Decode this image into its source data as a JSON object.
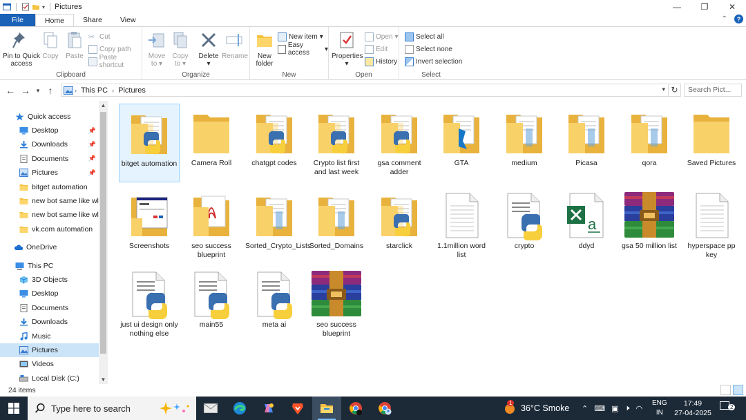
{
  "window": {
    "title": "Pictures"
  },
  "tabs": [
    {
      "label": "File"
    },
    {
      "label": "Home"
    },
    {
      "label": "Share"
    },
    {
      "label": "View"
    }
  ],
  "ribbon": {
    "clipboard": {
      "label": "Clipboard",
      "pin": "Pin to Quick access",
      "copy": "Copy",
      "paste": "Paste",
      "cut": "Cut",
      "copy_path": "Copy path",
      "paste_shortcut": "Paste shortcut"
    },
    "organize": {
      "label": "Organize",
      "move_to": "Move to",
      "copy_to": "Copy to",
      "delete": "Delete",
      "rename": "Rename"
    },
    "new": {
      "label": "New",
      "new_folder": "New folder",
      "new_item": "New item",
      "easy_access": "Easy access"
    },
    "open": {
      "label": "Open",
      "properties": "Properties",
      "open": "Open",
      "edit": "Edit",
      "history": "History"
    },
    "select": {
      "label": "Select",
      "select_all": "Select all",
      "select_none": "Select none",
      "invert": "Invert selection"
    }
  },
  "address": {
    "crumbs": [
      "This PC",
      "Pictures"
    ],
    "search_placeholder": "Search Pict..."
  },
  "nav": {
    "quick_access": "Quick access",
    "qa_items": [
      "Desktop",
      "Downloads",
      "Documents",
      "Pictures",
      "bitget automation",
      "new bot same like wl p",
      "new bot same like wl p",
      "vk.com automation"
    ],
    "onedrive": "OneDrive",
    "this_pc": "This PC",
    "pc_items": [
      "3D Objects",
      "Desktop",
      "Documents",
      "Downloads",
      "Music",
      "Pictures",
      "Videos",
      "Local Disk (C:)"
    ]
  },
  "files": [
    {
      "name": "bitget automation",
      "type": "folder-py"
    },
    {
      "name": "Camera Roll",
      "type": "folder"
    },
    {
      "name": "chatgpt codes",
      "type": "folder-py"
    },
    {
      "name": "Crypto list first and last week",
      "type": "folder-py"
    },
    {
      "name": "gsa comment adder",
      "type": "folder-py"
    },
    {
      "name": "GTA",
      "type": "folder-blue"
    },
    {
      "name": "medium",
      "type": "folder-doc"
    },
    {
      "name": "Picasa",
      "type": "folder-doc"
    },
    {
      "name": "qora",
      "type": "folder-doc"
    },
    {
      "name": "Saved Pictures",
      "type": "folder"
    },
    {
      "name": "Screenshots",
      "type": "folder-shot"
    },
    {
      "name": "seo success blueprint",
      "type": "folder-pdf"
    },
    {
      "name": "Sorted_Crypto_Lists",
      "type": "folder-doc"
    },
    {
      "name": "Sorted_Domains",
      "type": "folder-doc"
    },
    {
      "name": "starclick",
      "type": "folder-py"
    },
    {
      "name": "1.1million word list",
      "type": "text"
    },
    {
      "name": "crypto",
      "type": "python"
    },
    {
      "name": "ddyd",
      "type": "excel"
    },
    {
      "name": "gsa 50 million list",
      "type": "rar"
    },
    {
      "name": "hyperspace pp key",
      "type": "text"
    },
    {
      "name": "just ui design only nothing else",
      "type": "python"
    },
    {
      "name": "main55",
      "type": "python"
    },
    {
      "name": "meta ai",
      "type": "python"
    },
    {
      "name": "seo success blueprint",
      "type": "rar"
    }
  ],
  "status": {
    "count": "24 items"
  },
  "taskbar": {
    "search": "Type here to search",
    "weather": "36°C Smoke",
    "weather_badge": "1",
    "lang_top": "ENG",
    "lang_bottom": "IN",
    "time": "17:49",
    "date": "27-04-2025",
    "notifications": "2"
  }
}
